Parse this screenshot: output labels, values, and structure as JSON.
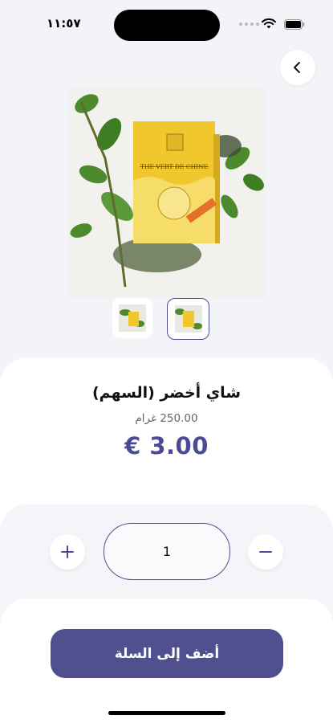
{
  "status_bar": {
    "time": "١١:٥٧"
  },
  "product": {
    "name": "شاي أخضر (السهم)",
    "weight": "250.00 غرام",
    "price": "€ 3.00",
    "package_text": "THE VERT DE CHINE"
  },
  "quantity": {
    "value": "1"
  },
  "actions": {
    "add_to_cart_label": "أضف إلى السلة"
  },
  "icons": {
    "back": "chevron-left-icon",
    "plus": "plus-icon",
    "minus": "minus-icon",
    "wifi": "wifi-icon",
    "battery": "battery-icon"
  },
  "colors": {
    "accent": "#51508f",
    "price": "#4b4b93",
    "background": "#f3f4f8",
    "card": "#ffffff"
  }
}
